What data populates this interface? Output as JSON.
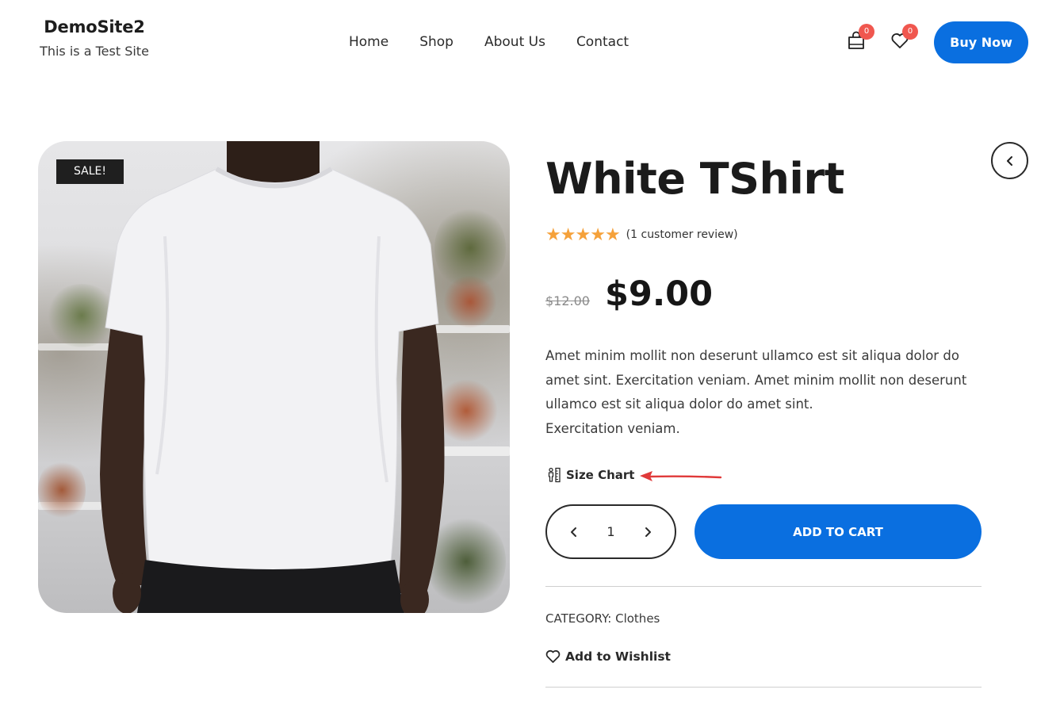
{
  "site": {
    "title": "DemoSite2",
    "tagline": "This is a Test Site"
  },
  "nav": {
    "items": [
      {
        "label": "Home"
      },
      {
        "label": "Shop"
      },
      {
        "label": "About Us"
      },
      {
        "label": "Contact"
      }
    ]
  },
  "header": {
    "cart_count": "0",
    "wishlist_count": "0",
    "buy_now_label": "Buy Now",
    "icons": [
      "shopping-bag-icon",
      "heart-icon"
    ]
  },
  "product": {
    "sale_badge": "SALE!",
    "title": "White TShirt",
    "rating": 5,
    "rating_max": 5,
    "review_text": "(1 customer review)",
    "old_price": "$12.00",
    "price": "$9.00",
    "description_lines": [
      "Amet minim mollit non deserunt ullamco est sit aliqua dolor do",
      "amet sint. Exercitation veniam. Amet minim mollit non deserunt",
      "ullamco est sit aliqua dolor do amet sint.",
      "Exercitation veniam."
    ],
    "size_chart_label": "Size Chart",
    "quantity": "1",
    "add_to_cart_label": "ADD TO CART",
    "category_label": "CATEGORY:",
    "category_value": "Clothes",
    "wishlist_label": "Add to Wishlist"
  },
  "colors": {
    "accent": "#0a6fe0",
    "badge": "#f0574f",
    "star": "#f5a13a",
    "annotation_arrow": "#e03a3a"
  }
}
